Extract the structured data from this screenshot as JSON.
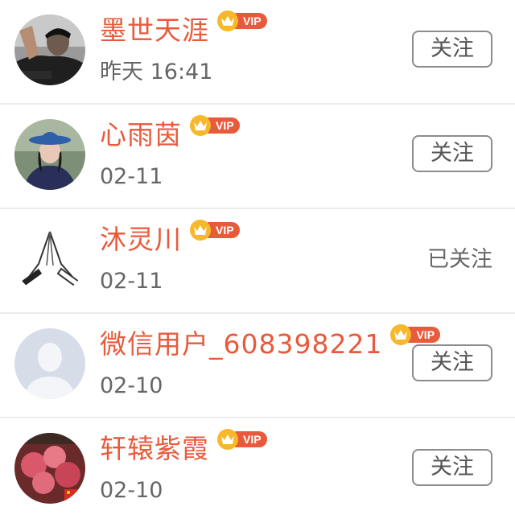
{
  "colors": {
    "name": "#e85a3c",
    "vip_badge": "#e85a3c",
    "crown": "#f7b82b",
    "time": "#666666",
    "button_border": "#8c8c8c"
  },
  "users": [
    {
      "name": "墨世天涯",
      "badge": "VIP",
      "time": "昨天 16:41",
      "action": "关注",
      "followed": false,
      "avatar_icon": "person-photo-avatar"
    },
    {
      "name": "心雨茵",
      "badge": "VIP",
      "time": "02-11",
      "action": "关注",
      "followed": false,
      "avatar_icon": "woman-hat-photo-avatar"
    },
    {
      "name": "沐灵川",
      "badge": "VIP",
      "time": "02-11",
      "action": "已关注",
      "followed": true,
      "avatar_icon": "praying-hands-avatar"
    },
    {
      "name": "微信用户_608398221",
      "badge": "VIP",
      "time": "02-10",
      "action": "关注",
      "followed": false,
      "avatar_icon": "default-user-avatar"
    },
    {
      "name": "轩辕紫霞",
      "badge": "VIP",
      "time": "02-10",
      "action": "关注",
      "followed": false,
      "avatar_icon": "flowers-photo-avatar"
    }
  ]
}
